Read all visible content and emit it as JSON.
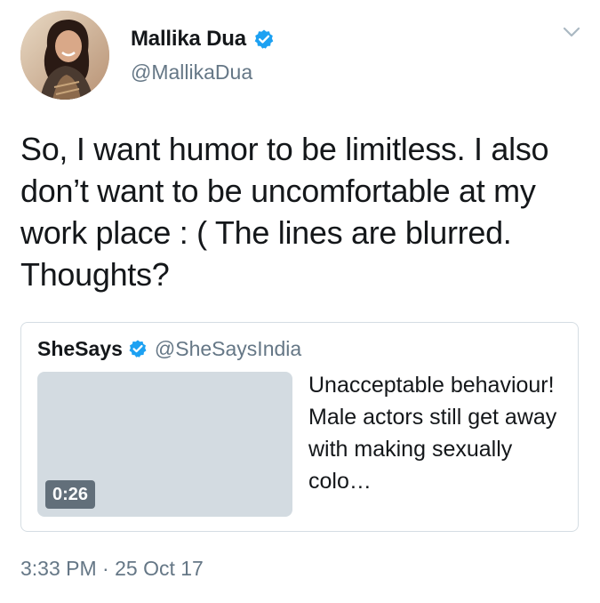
{
  "author": {
    "display_name": "Mallika Dua",
    "handle": "@MallikaDua",
    "verified": true,
    "avatar_icon": "profile-photo"
  },
  "tweet": {
    "text": "So, I want humor to be limitless. I also don’t want to be uncomfortable at my work place : ( The lines are blurred. Thoughts?",
    "timestamp": "3:33 PM · 25 Oct 17"
  },
  "quoted_tweet": {
    "display_name": "SheSays",
    "handle": "@SheSaysIndia",
    "verified": true,
    "video_duration": "0:26",
    "text": "Unacceptable behaviour! Male actors still get away with making sexually colo…"
  },
  "colors": {
    "primary_text": "#14171a",
    "secondary_text": "#657786",
    "verified_blue": "#1da1f2",
    "border": "#d5dde3",
    "media_placeholder": "#d3dbe1"
  }
}
